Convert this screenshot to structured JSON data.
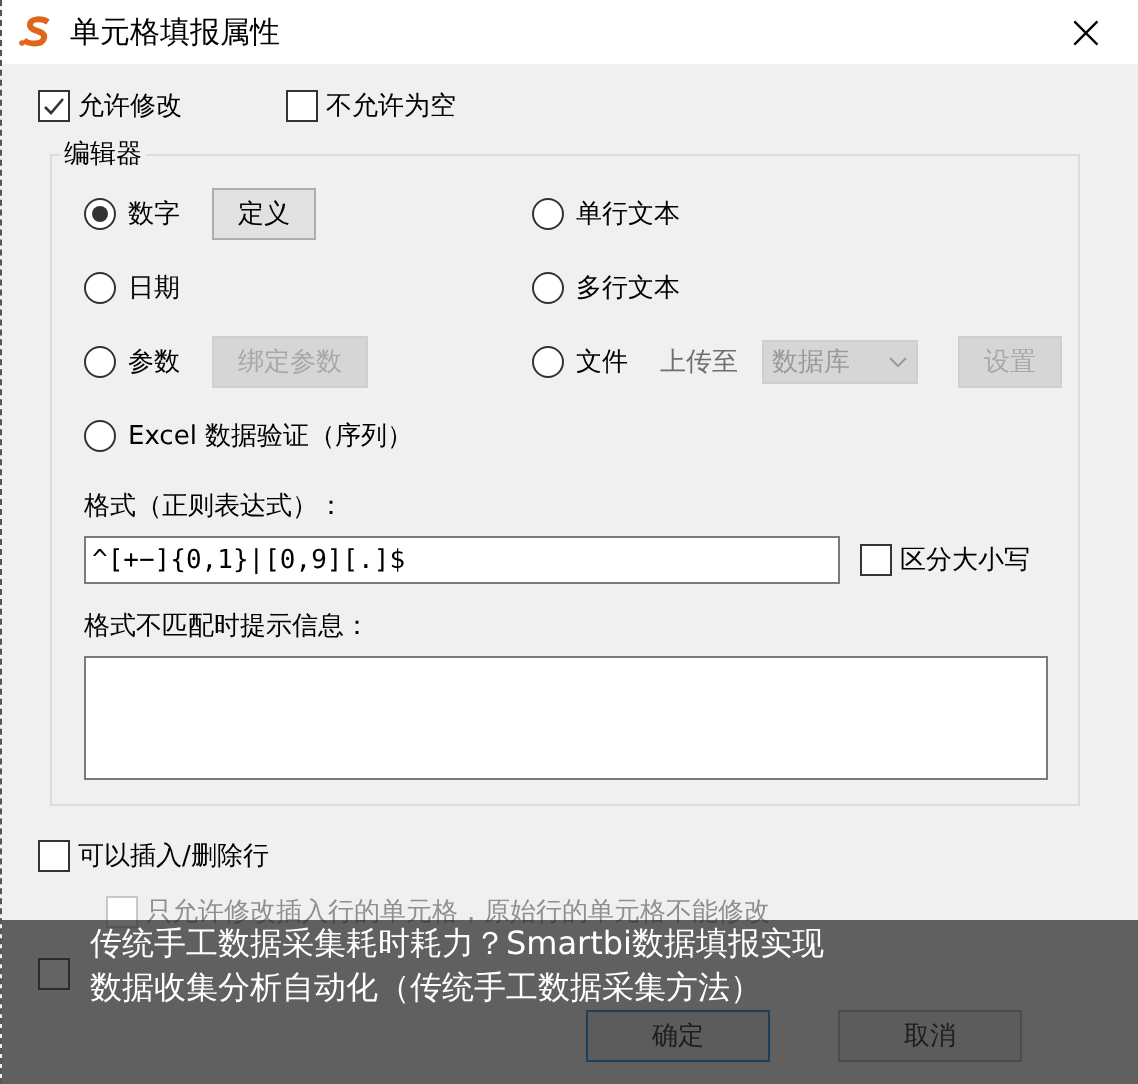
{
  "window": {
    "title": "单元格填报属性",
    "close": "×"
  },
  "options": [
    {
      "label": "允许修改",
      "checked": true
    },
    {
      "label": "不允许为空",
      "checked": false
    }
  ],
  "editor": {
    "title": "编辑器",
    "types": [
      {
        "label": "数字",
        "selected": true,
        "button": {
          "label": "定义",
          "disabled": false
        }
      },
      {
        "label": "单行文本",
        "selected": false
      },
      {
        "label": "日期",
        "selected": false
      },
      {
        "label": "多行文本",
        "selected": false
      },
      {
        "label": "参数",
        "selected": false,
        "button": {
          "label": "绑定参数",
          "disabled": true
        }
      },
      {
        "label": "文件",
        "selected": false,
        "upload_label": "上传至",
        "upload_target": "数据库",
        "button": {
          "label": "设置",
          "disabled": true
        }
      },
      {
        "label": "Excel 数据验证（序列）",
        "selected": false
      }
    ],
    "format_label": "格式（正则表达式）：",
    "format_value": "^[+−]{0,1}|[0,9][.]$",
    "case_sensitive": {
      "label": "区分大小写",
      "checked": false
    },
    "mismatch_label": "格式不匹配时提示信息："
  },
  "insert_rows": {
    "label": "可以插入/删除行",
    "checked": false
  },
  "insert_only": {
    "label": "只允许修改插入行的单元格，原始行的单元格不能修改",
    "checked": false,
    "disabled": true
  },
  "hidden_option": {
    "checked": false
  },
  "buttons": [
    "确定",
    "取消"
  ],
  "caption": {
    "lines": [
      "传统手工数据采集耗时耗力？Smartbi数据填报实现",
      "数据收集分析自动化（传统手工数据采集方法）"
    ]
  }
}
